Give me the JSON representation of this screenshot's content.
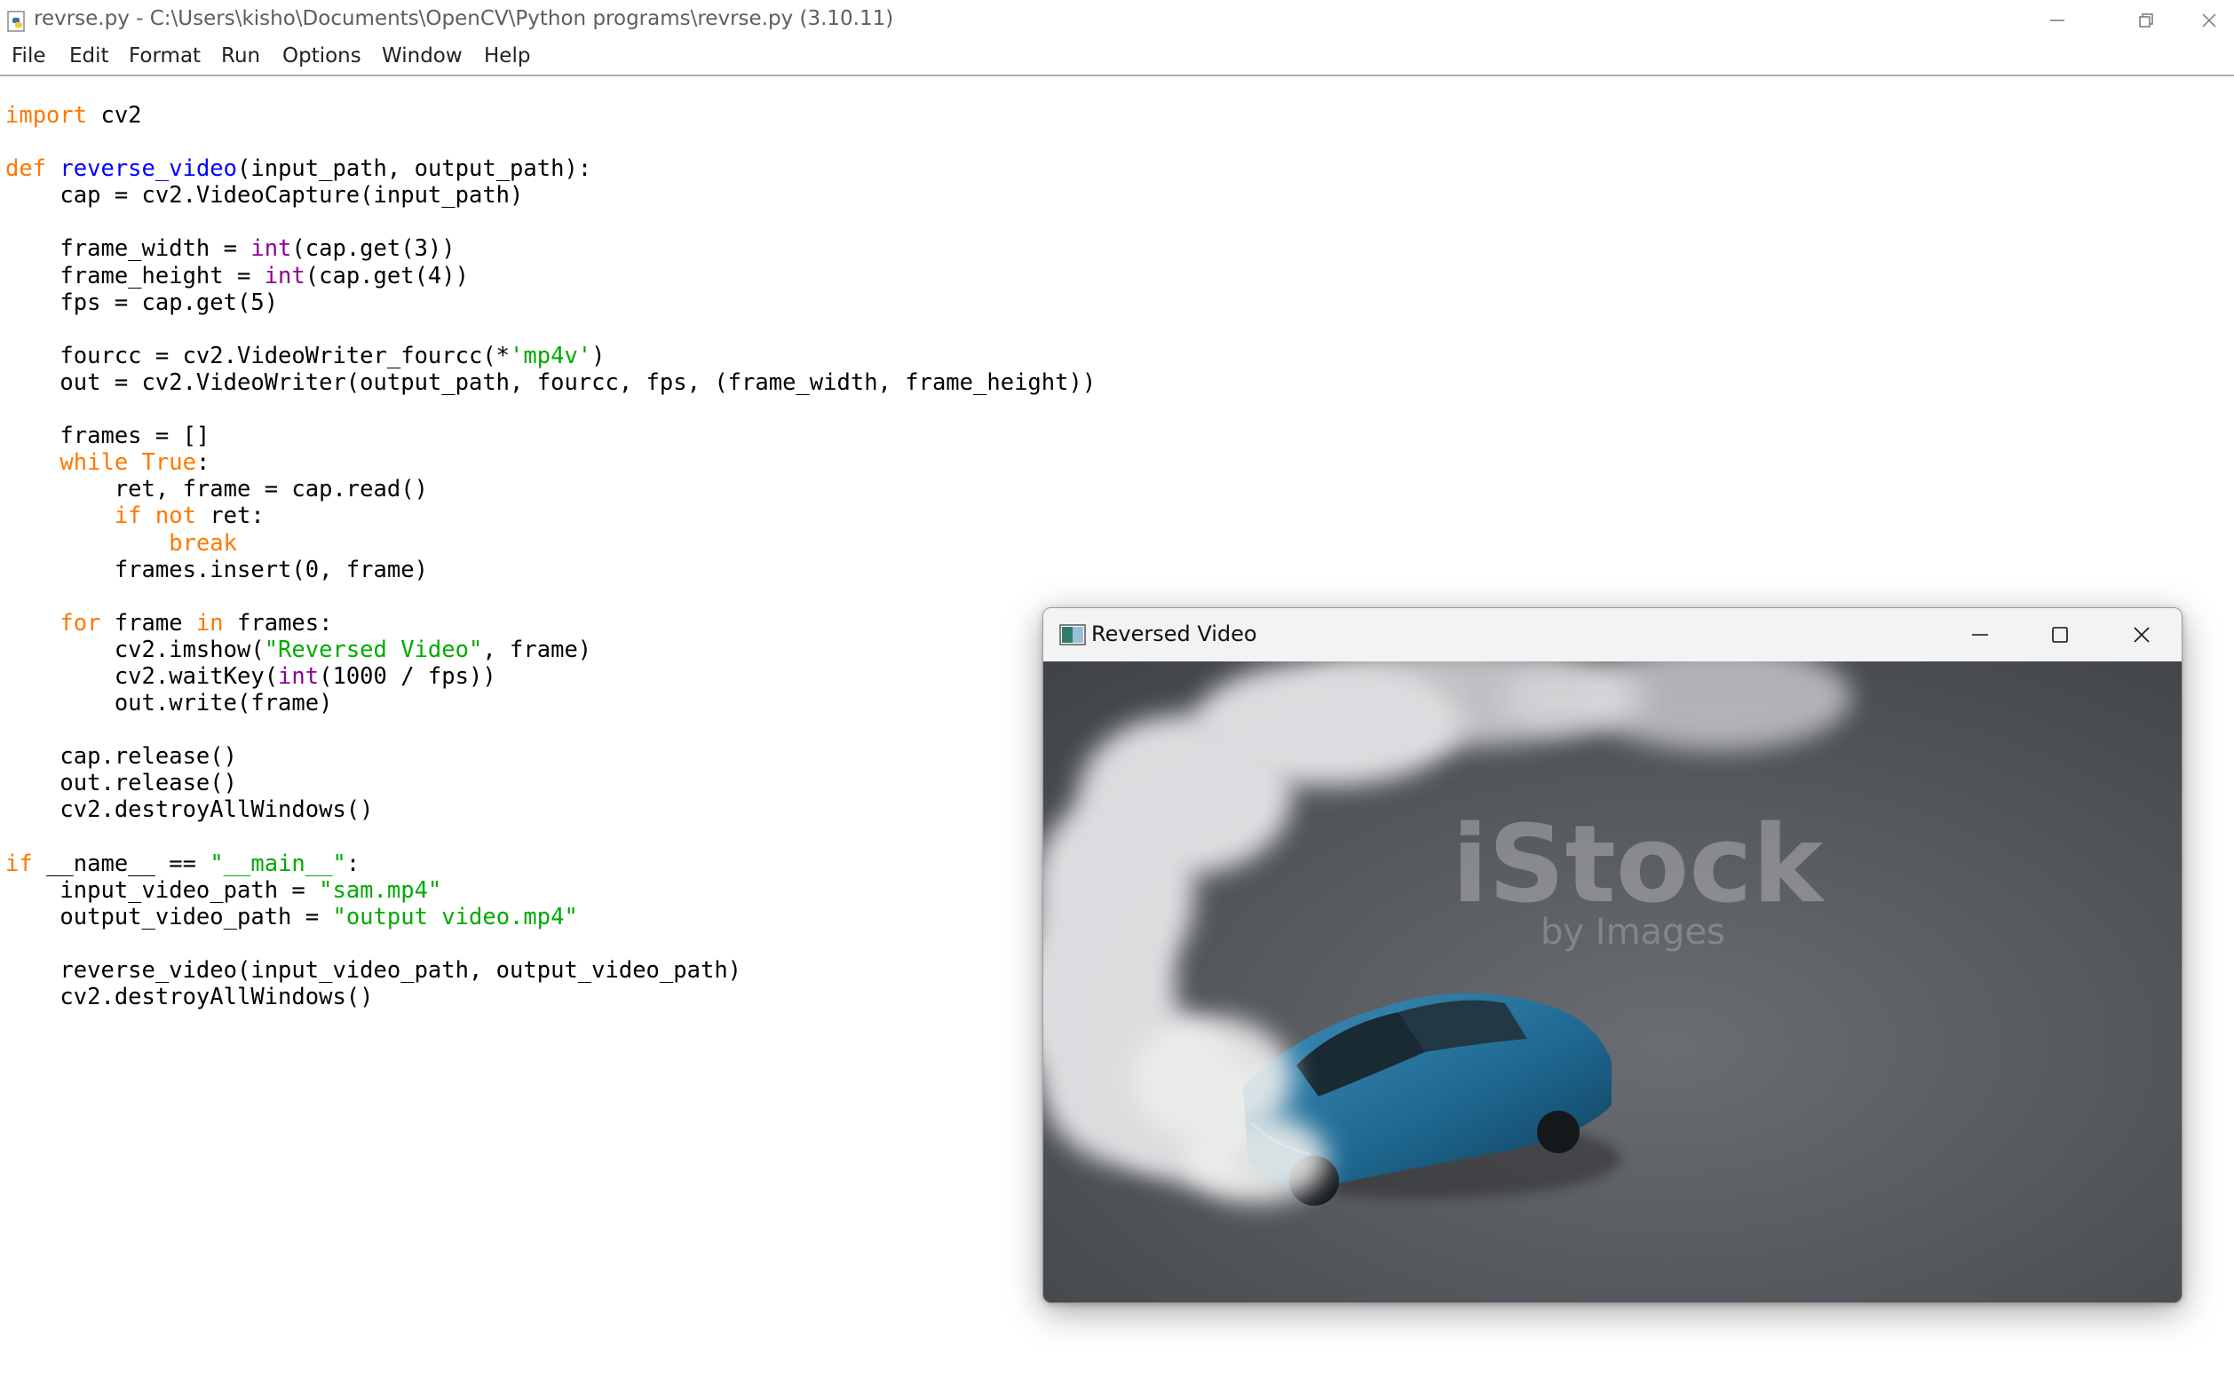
{
  "window": {
    "title": "revrse.py - C:\\Users\\kisho\\Documents\\OpenCV\\Python programs\\revrse.py (3.10.11)",
    "controls": {
      "minimize": "minimize-icon",
      "restore": "restore-icon",
      "close": "close-icon"
    }
  },
  "menu": {
    "file": "File",
    "edit": "Edit",
    "format": "Format",
    "run": "Run",
    "options": "Options",
    "window": "Window",
    "help": "Help"
  },
  "code": {
    "l1_import": "import",
    "l1_rest": " cv2",
    "l3_def": "def",
    "l3_name": "reverse_video",
    "l3_rest": "(input_path, output_path):",
    "l4": "    cap = cv2.VideoCapture(input_path)",
    "l6_a": "    frame_width = ",
    "l6_int": "int",
    "l6_b": "(cap.get(3))",
    "l7_a": "    frame_height = ",
    "l7_int": "int",
    "l7_b": "(cap.get(4))",
    "l8": "    fps = cap.get(5)",
    "l10_a": "    fourcc = cv2.VideoWriter_fourcc(*",
    "l10_str": "'mp4v'",
    "l10_b": ")",
    "l11": "    out = cv2.VideoWriter(output_path, fourcc, fps, (frame_width, frame_height))",
    "l13": "    frames = []",
    "l14_ind": "    ",
    "l14_while": "while",
    "l14_sp": " ",
    "l14_true": "True",
    "l14_rest": ":",
    "l15": "        ret, frame = cap.read()",
    "l16_ind": "        ",
    "l16_if": "if",
    "l16_sp": " ",
    "l16_not": "not",
    "l16_rest": " ret:",
    "l17_ind": "            ",
    "l17_break": "break",
    "l18": "        frames.insert(0, frame)",
    "l20_ind": "    ",
    "l20_for": "for",
    "l20_a": " frame ",
    "l20_in": "in",
    "l20_b": " frames:",
    "l21_a": "        cv2.imshow(",
    "l21_str": "\"Reversed Video\"",
    "l21_b": ", frame)",
    "l22_a": "        cv2.waitKey(",
    "l22_int": "int",
    "l22_b": "(1000 / fps))",
    "l23": "        out.write(frame)",
    "l25": "    cap.release()",
    "l26": "    out.release()",
    "l27": "    cv2.destroyAllWindows()",
    "l29_if": "if",
    "l29_a": " __name__ == ",
    "l29_str": "\"__main__\"",
    "l29_b": ":",
    "l30_a": "    input_video_path = ",
    "l30_str": "\"sam.mp4\"",
    "l31_a": "    output_video_path = ",
    "l31_str": "\"output video.mp4\"",
    "l33": "    reverse_video(input_video_path, output_video_path)",
    "l34": "    cv2.destroyAllWindows()"
  },
  "syntax_colors": {
    "keyword": "#ff7700",
    "builtin": "#900090",
    "string": "#00aa00",
    "definition": "#0000ff"
  },
  "video_window": {
    "title": "Reversed Video",
    "watermark": "iStock",
    "watermark_sub": "by Images",
    "controls": {
      "minimize": "minimize-icon",
      "maximize": "maximize-icon",
      "close": "close-icon"
    }
  }
}
